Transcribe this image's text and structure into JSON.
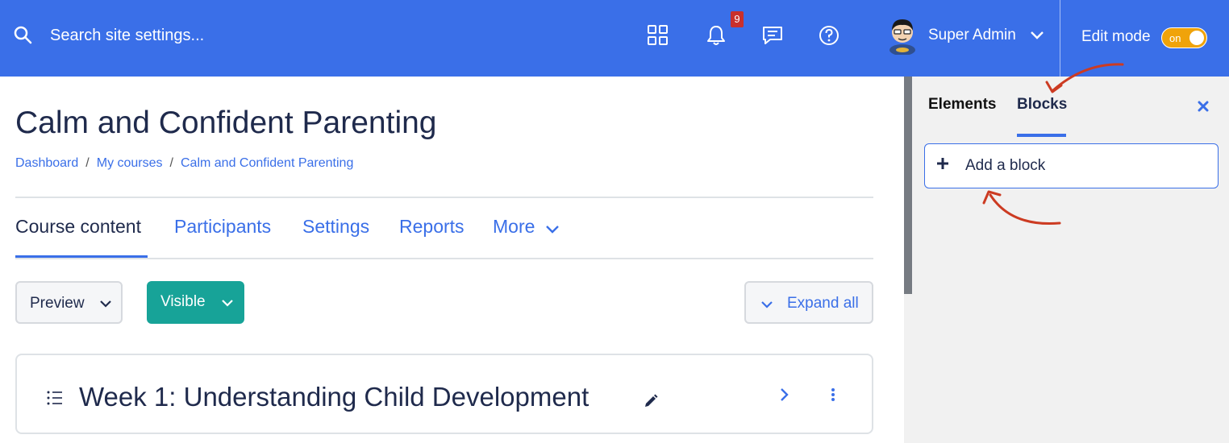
{
  "navbar": {
    "search_placeholder": "Search site settings...",
    "notification_count": "9",
    "user_name": "Super Admin",
    "edit_mode_label": "Edit mode",
    "edit_mode_toggle": "on",
    "icons": [
      "search-icon",
      "apps-grid-icon",
      "bell-icon",
      "messages-icon",
      "help-icon",
      "avatar",
      "chevron-down-icon"
    ]
  },
  "page": {
    "title": "Calm and Confident Parenting",
    "breadcrumb": [
      "Dashboard",
      "My courses",
      "Calm and Confident Parenting"
    ],
    "tabs": [
      "Course content",
      "Participants",
      "Settings",
      "Reports",
      "More"
    ],
    "active_tab": "Course content"
  },
  "toolbar": {
    "preview_label": "Preview",
    "visible_label": "Visible",
    "expand_all_label": "Expand all"
  },
  "section": {
    "title": "Week 1: Understanding Child Development"
  },
  "drawer": {
    "tabs": [
      "Elements",
      "Blocks"
    ],
    "active_tab": "Blocks",
    "add_block_label": "Add a block"
  },
  "colors": {
    "navbar": "#3a6fe8",
    "accent": "#3a6fe8",
    "visible_button": "#17a398",
    "toggle": "#f0a30a",
    "badge": "#c9302c",
    "annotation_arrow": "#cc3b22"
  }
}
